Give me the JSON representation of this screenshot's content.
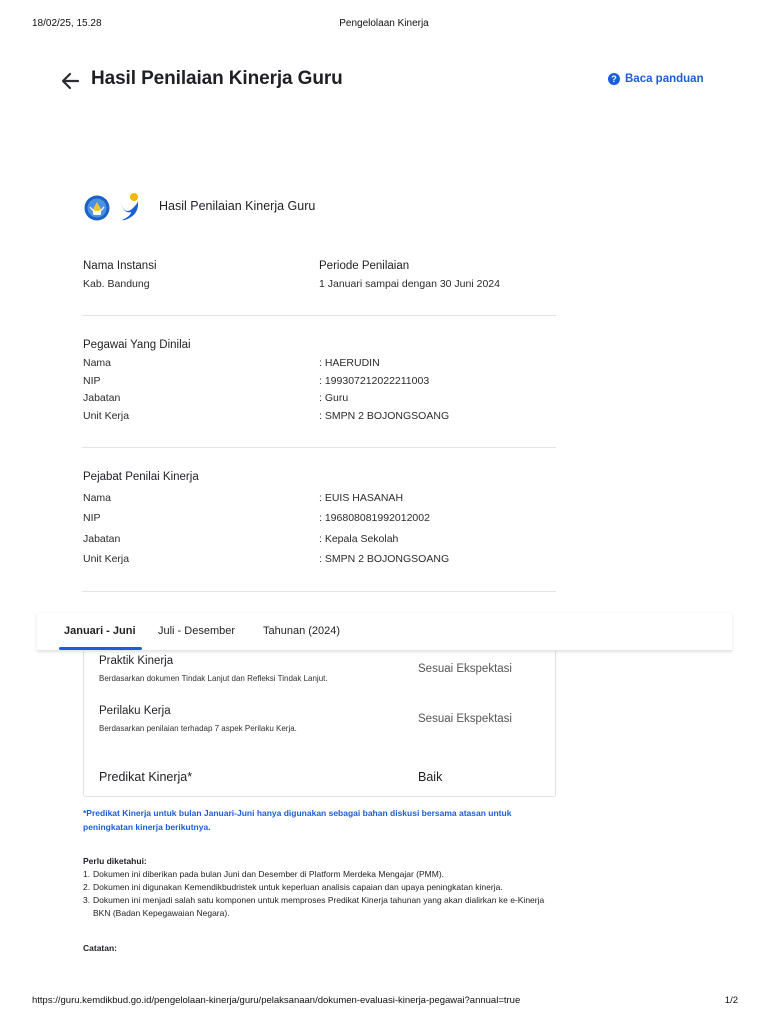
{
  "print_header": {
    "datetime": "18/02/25, 15.28",
    "title": "Pengelolaan Kinerja"
  },
  "print_footer": {
    "url": "https://guru.kemdikbud.go.id/pengelolaan-kinerja/guru/pelaksanaan/dokumen-evaluasi-kinerja-pegawai?annual=true",
    "page": "1/2"
  },
  "header": {
    "back_icon": "arrow-left-icon",
    "title": "Hasil Penilaian Kinerja Guru",
    "guide_icon": "question-circle-icon",
    "guide_label": "Baca panduan"
  },
  "document": {
    "logos": [
      "tut-wuri-handayani-logo",
      "merdeka-mengajar-logo"
    ],
    "title": "Hasil Penilaian Kinerja Guru",
    "instansi": {
      "label": "Nama Instansi",
      "value": "Kab. Bandung"
    },
    "periode": {
      "label": "Periode Penilaian",
      "value": "1 Januari sampai dengan 30 Juni 2024"
    },
    "pegawai": {
      "heading": "Pegawai Yang Dinilai",
      "rows": [
        {
          "label": "Nama",
          "value": ": HAERUDIN"
        },
        {
          "label": "NIP",
          "value": ": 199307212022211003"
        },
        {
          "label": "Jabatan",
          "value": ": Guru"
        },
        {
          "label": "Unit Kerja",
          "value": ": SMPN 2 BOJONGSOANG"
        }
      ]
    },
    "pejabat": {
      "heading": "Pejabat Penilai Kinerja",
      "rows": [
        {
          "label": "Nama",
          "value": ": EUIS HASANAH"
        },
        {
          "label": "NIP",
          "value": ": 196808081992012002"
        },
        {
          "label": "Jabatan",
          "value": ": Kepala Sekolah"
        },
        {
          "label": "Unit Kerja",
          "value": ": SMPN 2 BOJONGSOANG"
        }
      ]
    }
  },
  "tabs": [
    {
      "label": "Januari - Juni",
      "active": true
    },
    {
      "label": "Juli - Desember",
      "active": false
    },
    {
      "label": "Tahunan (2024)",
      "active": false
    }
  ],
  "results": {
    "items": [
      {
        "label": "Praktik Kinerja",
        "desc": "Berdasarkan dokumen Tindak Lanjut dan Refleksi Tindak Lanjut.",
        "value": "Sesuai Ekspektasi"
      },
      {
        "label": "Perilaku Kerja",
        "desc": "Berdasarkan penilaian terhadap 7 aspek Perilaku Kerja.",
        "value": "Sesuai Ekspektasi"
      }
    ],
    "predikat": {
      "label": "Predikat Kinerja*",
      "value": "Baik"
    }
  },
  "notes": {
    "blue_note": "*Predikat Kinerja untuk bulan Januari-Juni hanya digunakan sebagai bahan diskusi bersama atasan untuk peningkatan kinerja berikutnya.",
    "known_title": "Perlu diketahui:",
    "known_items": [
      {
        "num": "1.",
        "text": "Dokumen ini diberikan pada bulan Juni dan Desember di Platform Merdeka Mengajar (PMM)."
      },
      {
        "num": "2.",
        "text": "Dokumen ini digunakan Kemendikbudristek untuk keperluan analisis capaian dan upaya peningkatan kinerja."
      },
      {
        "num": "3.",
        "text": "Dokumen ini menjadi salah satu komponen untuk memproses Predikat Kinerja tahunan yang akan dialirkan ke e-Kinerja BKN (Badan Kepegawaian Negara)."
      }
    ],
    "catatan": "Catatan:"
  },
  "colors": {
    "accent": "#1a5ed8",
    "text": "#1f2024",
    "divider": "#e2e4e8"
  }
}
